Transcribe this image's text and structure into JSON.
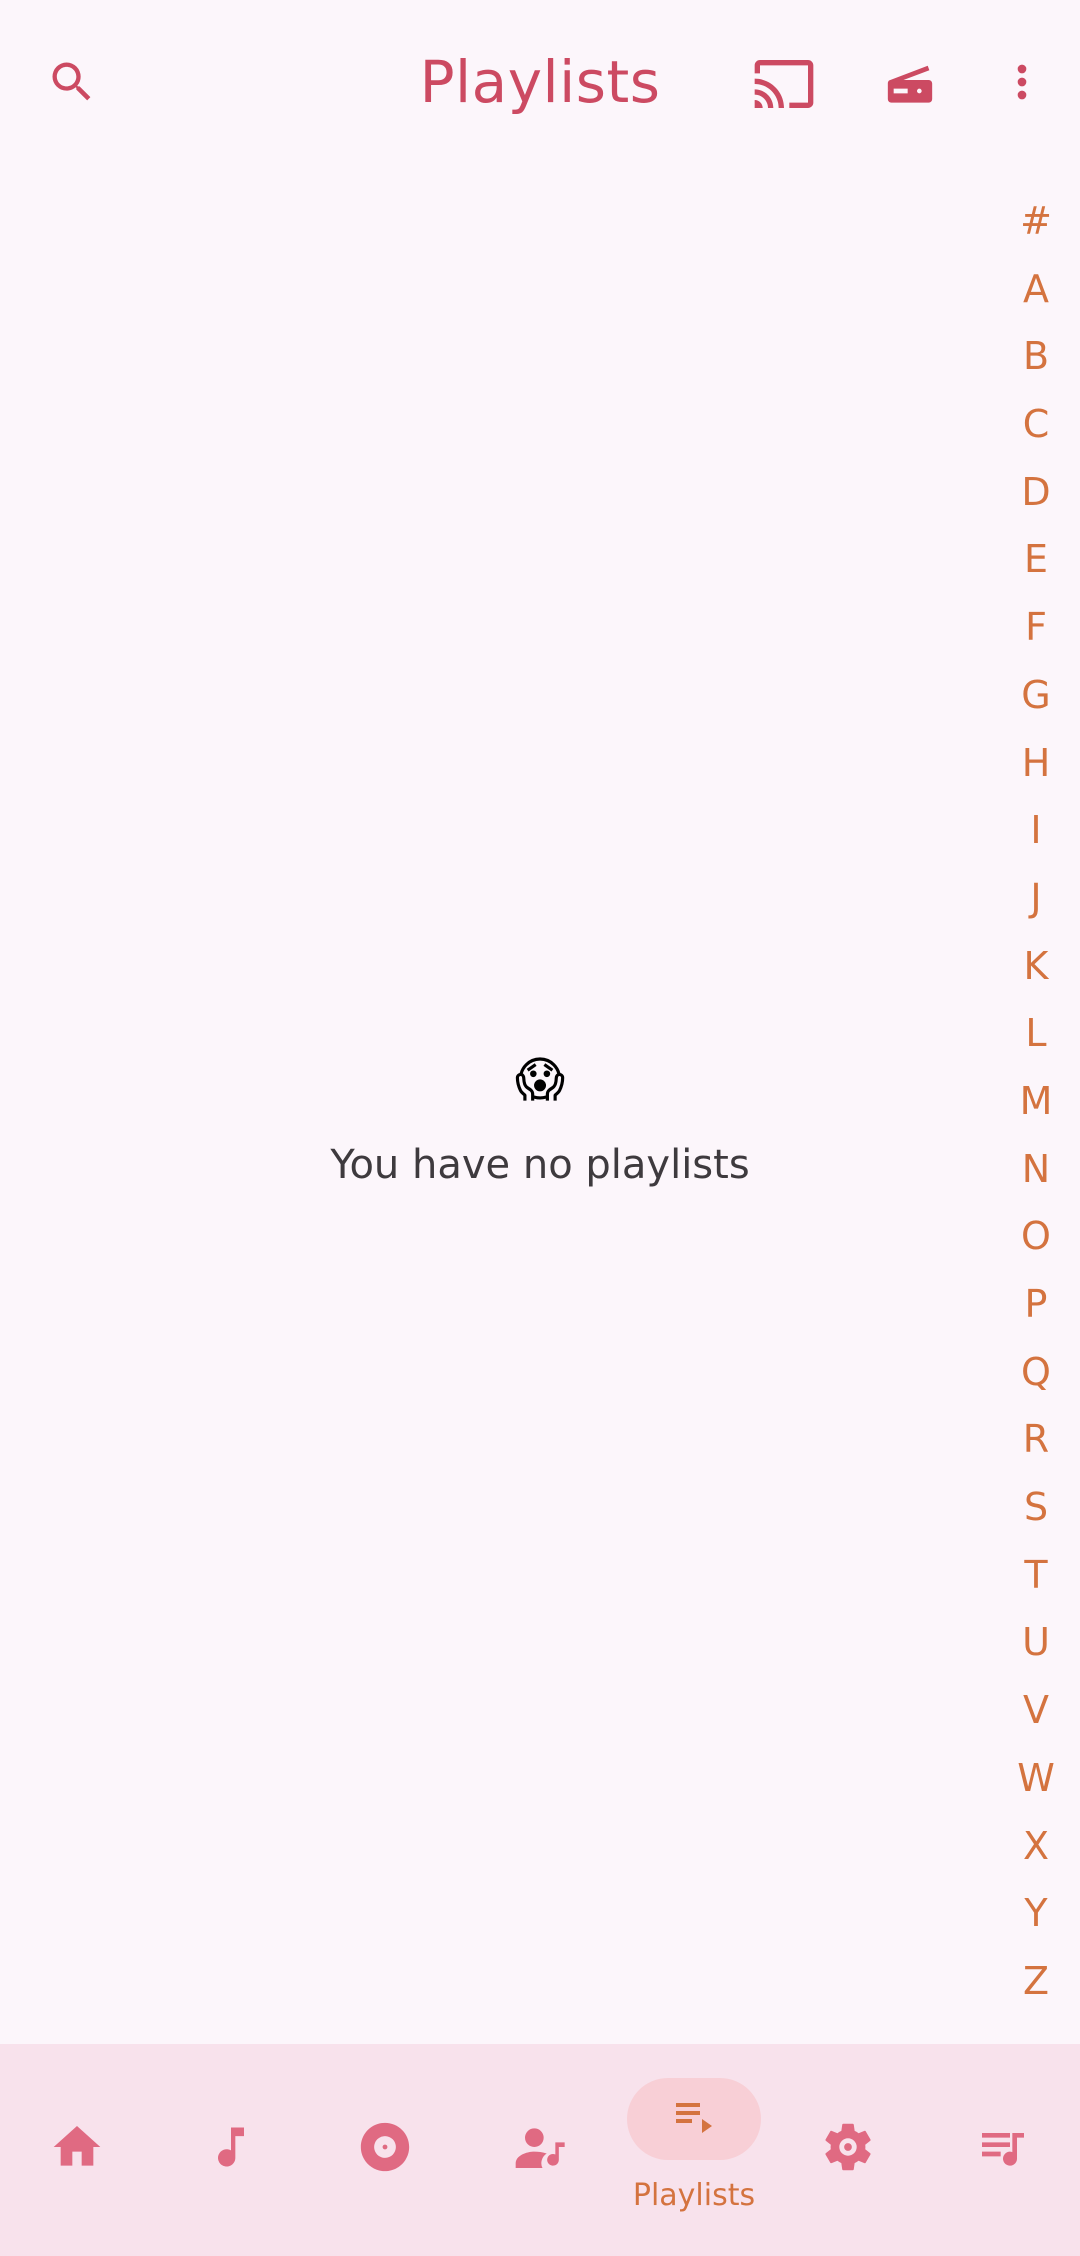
{
  "header": {
    "title": "Playlists",
    "icons": [
      "search-icon",
      "cast-icon",
      "radio-icon",
      "more-vert-icon"
    ]
  },
  "alphabet": [
    "#",
    "A",
    "B",
    "C",
    "D",
    "E",
    "F",
    "G",
    "H",
    "I",
    "J",
    "K",
    "L",
    "M",
    "N",
    "O",
    "P",
    "Q",
    "R",
    "S",
    "T",
    "U",
    "V",
    "W",
    "X",
    "Y",
    "Z"
  ],
  "empty_state": {
    "emoji": "😱",
    "message": "You have no playlists"
  },
  "bottom_nav": {
    "items": [
      {
        "icon": "home-icon",
        "label": ""
      },
      {
        "icon": "music-note-icon",
        "label": ""
      },
      {
        "icon": "album-icon",
        "label": ""
      },
      {
        "icon": "artist-icon",
        "label": ""
      },
      {
        "icon": "playlist-play-icon",
        "label": "Playlists",
        "active": true
      },
      {
        "icon": "settings-icon",
        "label": ""
      },
      {
        "icon": "queue-music-icon",
        "label": ""
      }
    ]
  },
  "colors": {
    "background": "#fcf6fb",
    "accent": "#cc4a62",
    "nav_accent": "#e06a82",
    "alphabet": "#d4733f",
    "nav_background": "#f8e2ec",
    "active_pill": "#f8cfd6"
  }
}
